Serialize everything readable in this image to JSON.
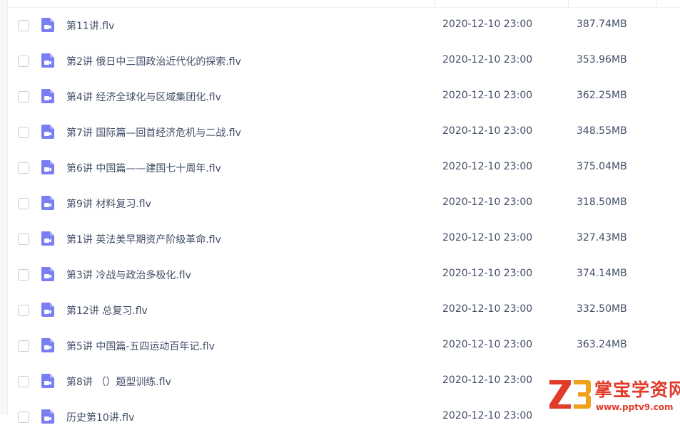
{
  "files": [
    {
      "name": "第11讲.flv",
      "date": "2020-12-10 23:00",
      "size": "387.74MB"
    },
    {
      "name": "第2讲 俄日中三国政治近代化的探索.flv",
      "date": "2020-12-10 23:00",
      "size": "353.96MB"
    },
    {
      "name": "第4讲 经济全球化与区域集团化.flv",
      "date": "2020-12-10 23:00",
      "size": "362.25MB"
    },
    {
      "name": "第7讲 国际篇—回首经济危机与二战.flv",
      "date": "2020-12-10 23:00",
      "size": "348.55MB"
    },
    {
      "name": "第6讲 中国篇——建国七十周年.flv",
      "date": "2020-12-10 23:00",
      "size": "375.04MB"
    },
    {
      "name": "第9讲 材料复习.flv",
      "date": "2020-12-10 23:00",
      "size": "318.50MB"
    },
    {
      "name": "第1讲 英法美早期资产阶级革命.flv",
      "date": "2020-12-10 23:00",
      "size": "327.43MB"
    },
    {
      "name": "第3讲 冷战与政治多极化.flv",
      "date": "2020-12-10 23:00",
      "size": "374.14MB"
    },
    {
      "name": "第12讲 总复习.flv",
      "date": "2020-12-10 23:00",
      "size": "332.50MB"
    },
    {
      "name": "第5讲 中国篇-五四运动百年记.flv",
      "date": "2020-12-10 23:00",
      "size": "363.24MB"
    },
    {
      "name": "第8讲 （）题型训练.flv",
      "date": "2020-12-10 23:00",
      "size": ""
    },
    {
      "name": "历史第10讲.flv",
      "date": "2020-12-10 23:00",
      "size": ""
    }
  ],
  "icons": {
    "file": "video-file-icon",
    "checkbox": "checkbox-icon"
  },
  "colors": {
    "icon": "#7a7ef0",
    "text": "#424e67",
    "watermark": "#e13b2a",
    "checkbox_border": "#c9ccd3"
  },
  "watermark": {
    "title": "掌宝学资网",
    "url": "www.pptv9.com",
    "logo": "Z3"
  }
}
